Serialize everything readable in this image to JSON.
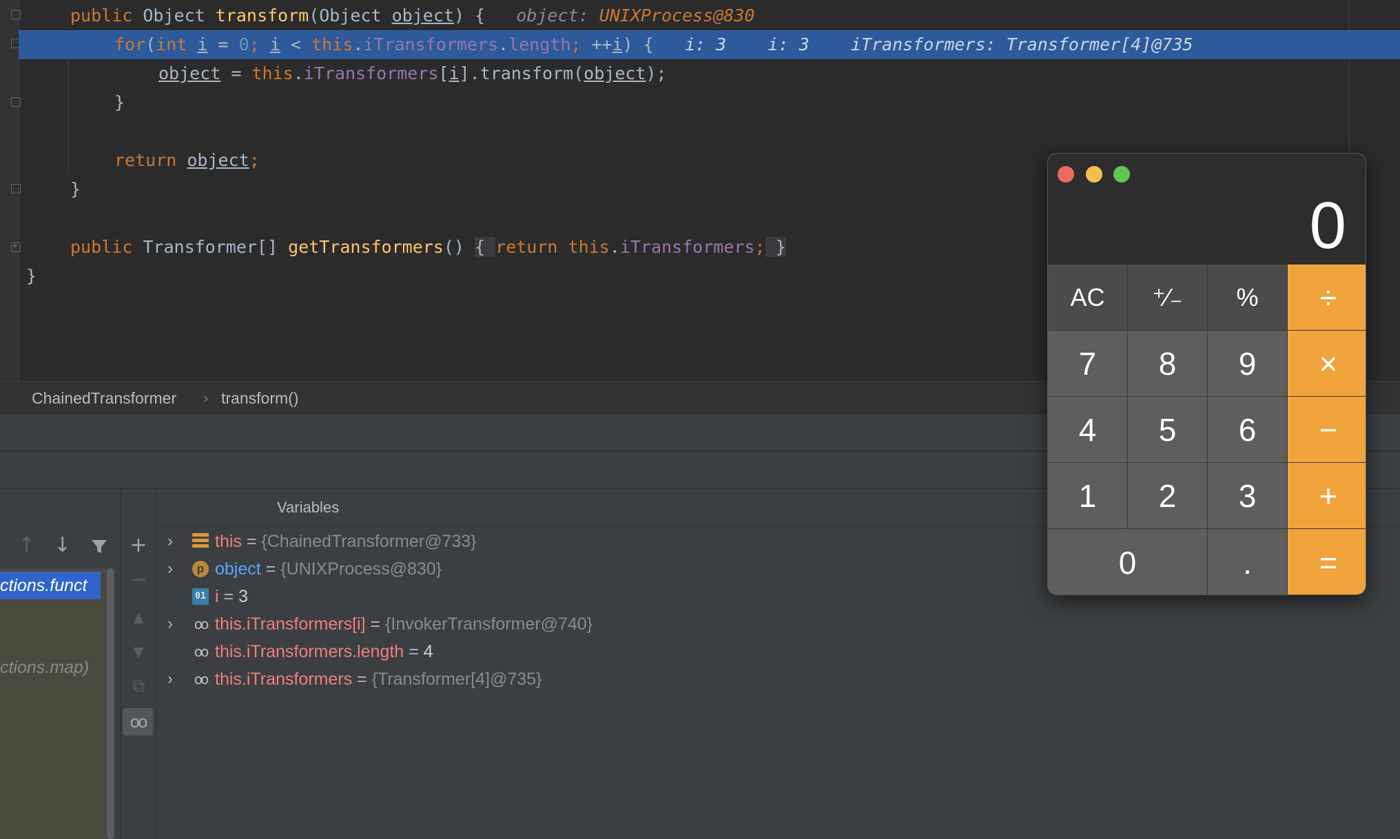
{
  "editor": {
    "line1": {
      "kw1": "public",
      "type": " Object ",
      "method": "transform",
      "paren": "(Object ",
      "param": "object",
      "close": ") {",
      "hint_name": "object:",
      "hint_value": "UNIXProcess@830"
    },
    "line2": {
      "for": "for",
      "open": "(",
      "int": "int",
      "sp": " ",
      "i1": "i",
      "eq": " = ",
      "zero": "0",
      "semi1": ";",
      "sp2": " ",
      "i2": "i",
      "lt": " < ",
      "this": "this",
      "dot": ".",
      "field": "iTransformers",
      "dot2": ".",
      "length": "length",
      "semi2": ";",
      "inc": " ++",
      "i3": "i",
      "close": ") {",
      "hint1": "i: 3",
      "hint2": "i: 3",
      "hint3": "iTransformers: Transformer[4]@735"
    },
    "line3": {
      "var": "object",
      "eq": " = ",
      "this": "this",
      "dot": ".",
      "field": "iTransformers",
      "br1": "[",
      "idx": "i",
      "br2": "].transform(",
      "arg": "object",
      "end": ");"
    },
    "line4": "}",
    "line5": {
      "ret": "return",
      "sp": " ",
      "var": "object",
      "end": ";"
    },
    "line6": "}",
    "line7": {
      "kw1": "public",
      "type": " Transformer[] ",
      "method": "getTransformers",
      "paren": "()",
      "sp": " ",
      "fold_open": "{ ",
      "ret": "return",
      "sp2": " ",
      "this": "this",
      "dot": ".",
      "field": "iTransformers",
      "semi": ";",
      "fold_close": " }"
    },
    "line8": "}"
  },
  "breadcrumb": {
    "class": "ChainedTransformer",
    "separator": "›",
    "method": "transform()"
  },
  "frames": {
    "up_icon": "↑",
    "down_icon": "↓",
    "filter_icon": "filter-icon",
    "selected_frame": "ctions.funct",
    "frame2": "ctions.map)"
  },
  "variables": {
    "title": "Variables",
    "side": {
      "add": "+",
      "remove": "−",
      "up": "▲",
      "down": "▼",
      "copy": "⧉",
      "watch": "oo"
    },
    "rows": [
      {
        "expand": "›",
        "name": "this",
        "eq": " = ",
        "value": "{ChainedTransformer@733}"
      },
      {
        "expand": "›",
        "name": "object",
        "eq": " = ",
        "value": "{UNIXProcess@830}",
        "icon_text": "p"
      },
      {
        "expand": "",
        "name": "i",
        "eq": " = ",
        "value": "3",
        "icon_text": "01"
      },
      {
        "expand": "›",
        "name": "this.iTransformers[i]",
        "eq": " = ",
        "value": "{InvokerTransformer@740}",
        "icon_text": "oo"
      },
      {
        "expand": "",
        "name": "this.iTransformers.length",
        "eq": " = ",
        "value": "4",
        "icon_text": "oo"
      },
      {
        "expand": "›",
        "name": "this.iTransformers",
        "eq": " = ",
        "value": "{Transformer[4]@735}",
        "icon_text": "oo"
      }
    ]
  },
  "calculator": {
    "display": "0",
    "keys": [
      "AC",
      "⁺∕₋",
      "%",
      "÷",
      "7",
      "8",
      "9",
      "×",
      "4",
      "5",
      "6",
      "−",
      "1",
      "2",
      "3",
      "+",
      "0",
      ".",
      "="
    ],
    "colors": {
      "close": "#ed6a5e",
      "minimize": "#f4be4f",
      "zoom": "#61c554",
      "operator": "#f1a43c"
    }
  }
}
